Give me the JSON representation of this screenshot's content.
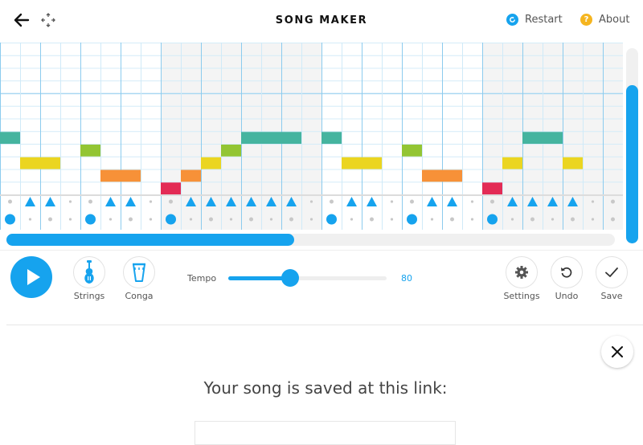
{
  "header": {
    "title": "SONG MAKER",
    "restart_label": "Restart",
    "about_label": "About",
    "restart_color": "#16a3ee",
    "about_color": "#f5b51f"
  },
  "grid": {
    "columns": 31,
    "melody_rows": 12,
    "shaded_measures": [
      [
        8,
        15
      ],
      [
        24,
        30
      ]
    ],
    "notes": [
      {
        "row": 4,
        "col": 0,
        "color": "#45b49f"
      },
      {
        "row": 2,
        "col": 1,
        "color": "#ebd520"
      },
      {
        "row": 2,
        "col": 2,
        "color": "#ebd520"
      },
      {
        "row": 3,
        "col": 4,
        "color": "#93c533"
      },
      {
        "row": 1,
        "col": 5,
        "color": "#f79138"
      },
      {
        "row": 1,
        "col": 6,
        "color": "#f79138"
      },
      {
        "row": 0,
        "col": 8,
        "color": "#e32b55"
      },
      {
        "row": 1,
        "col": 9,
        "color": "#f79138"
      },
      {
        "row": 2,
        "col": 10,
        "color": "#ebd520"
      },
      {
        "row": 3,
        "col": 11,
        "color": "#93c533"
      },
      {
        "row": 4,
        "col": 12,
        "color": "#45b49f"
      },
      {
        "row": 4,
        "col": 13,
        "color": "#45b49f"
      },
      {
        "row": 4,
        "col": 14,
        "color": "#45b49f"
      },
      {
        "row": 4,
        "col": 16,
        "color": "#45b49f"
      },
      {
        "row": 2,
        "col": 17,
        "color": "#ebd520"
      },
      {
        "row": 2,
        "col": 18,
        "color": "#ebd520"
      },
      {
        "row": 3,
        "col": 20,
        "color": "#93c533"
      },
      {
        "row": 1,
        "col": 21,
        "color": "#f79138"
      },
      {
        "row": 1,
        "col": 22,
        "color": "#f79138"
      },
      {
        "row": 0,
        "col": 24,
        "color": "#e32b55"
      },
      {
        "row": 2,
        "col": 25,
        "color": "#ebd520"
      },
      {
        "row": 4,
        "col": 26,
        "color": "#45b49f"
      },
      {
        "row": 4,
        "col": 27,
        "color": "#45b49f"
      },
      {
        "row": 2,
        "col": 28,
        "color": "#ebd520"
      }
    ],
    "percussion_triangles": [
      1,
      2,
      5,
      6,
      9,
      10,
      11,
      12,
      13,
      14,
      17,
      18,
      21,
      22,
      25,
      26,
      27,
      28
    ],
    "percussion_circles": [
      0,
      4,
      8,
      16,
      20,
      24
    ],
    "horizontal_scroll_fraction": 0.47,
    "vertical_scroll_fraction": 0.8
  },
  "controls": {
    "instrument_label": "Strings",
    "percussion_label": "Conga",
    "tempo_label": "Tempo",
    "tempo_value": "80",
    "tempo_fraction": 0.39,
    "settings_label": "Settings",
    "undo_label": "Undo",
    "save_label": "Save",
    "accent_color": "#16a3ee"
  },
  "dialog": {
    "message": "Your song is saved at this link:",
    "link_value": ""
  }
}
